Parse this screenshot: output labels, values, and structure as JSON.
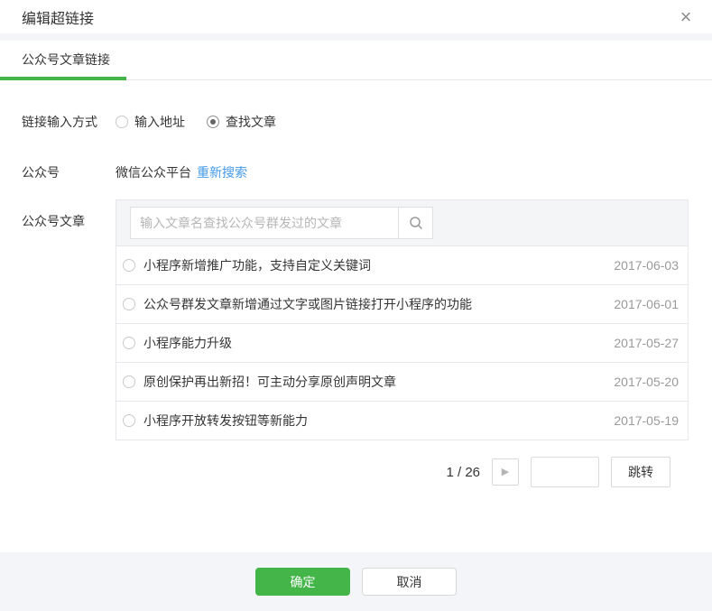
{
  "dialog": {
    "title": "编辑超链接",
    "close_icon": "×"
  },
  "tabs": [
    {
      "label": "公众号文章链接",
      "active": true
    }
  ],
  "form": {
    "link_input_method": {
      "label": "链接输入方式",
      "options": [
        {
          "label": "输入地址",
          "selected": false
        },
        {
          "label": "查找文章",
          "selected": true
        }
      ]
    },
    "account": {
      "label": "公众号",
      "value": "微信公众平台",
      "action_link": "重新搜索"
    },
    "articles": {
      "label": "公众号文章",
      "search_placeholder": "输入文章名查找公众号群发过的文章",
      "search_value": "",
      "items": [
        {
          "title": "小程序新增推广功能，支持自定义关键词",
          "date": "2017-06-03",
          "selected": false
        },
        {
          "title": "公众号群发文章新增通过文字或图片链接打开小程序的功能",
          "date": "2017-06-01",
          "selected": false
        },
        {
          "title": "小程序能力升级",
          "date": "2017-05-27",
          "selected": false
        },
        {
          "title": "原创保护再出新招！可主动分享原创声明文章",
          "date": "2017-05-20",
          "selected": false
        },
        {
          "title": "小程序开放转发按钮等新能力",
          "date": "2017-05-19",
          "selected": false
        }
      ]
    }
  },
  "pagination": {
    "page_indicator": "1 / 26",
    "current_page": 1,
    "total_pages": 26,
    "next_icon": "▶",
    "jump_value": "",
    "jump_label": "跳转"
  },
  "footer": {
    "confirm_label": "确定",
    "cancel_label": "取消"
  },
  "colors": {
    "accent_green": "#44b549",
    "link_blue": "#459ae9",
    "text_primary": "#353535",
    "text_secondary": "#9a9a9a",
    "band_gray": "#f4f5f8",
    "border_gray": "#e7e7eb"
  }
}
